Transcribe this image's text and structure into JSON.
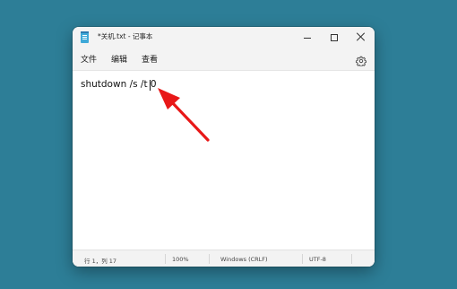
{
  "window": {
    "title": "*关机.txt - 记事本",
    "controls": {
      "minimize": "minimize",
      "maximize": "maximize",
      "close": "close"
    }
  },
  "menu": {
    "file": "文件",
    "edit": "编辑",
    "view": "查看",
    "settings_icon": "gear-icon"
  },
  "editor": {
    "content": "shutdown /s /t 0"
  },
  "status": {
    "position": "行 1，列 17",
    "zoom": "100%",
    "line_ending": "Windows (CRLF)",
    "encoding": "UTF-8"
  },
  "annotation": {
    "arrow_color": "#e81818"
  },
  "colors": {
    "desktop": "#2d7e97",
    "window_bg": "#f3f3f3",
    "editor_bg": "#ffffff"
  }
}
